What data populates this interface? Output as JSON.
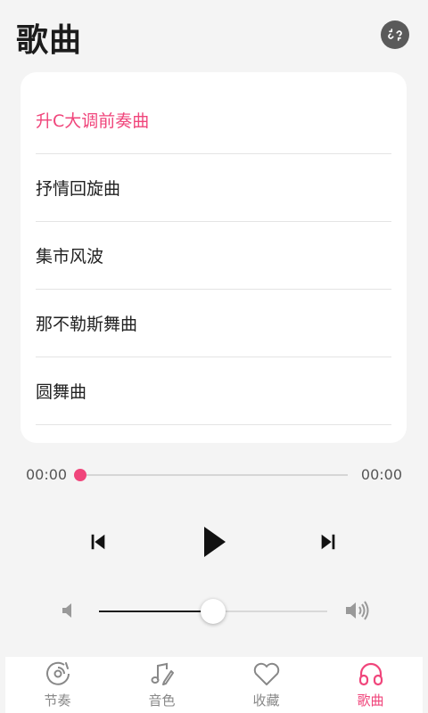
{
  "header": {
    "title": "歌曲",
    "unlink_icon": "unlink-icon"
  },
  "songs": [
    {
      "title": "升C大调前奏曲",
      "active": true
    },
    {
      "title": "抒情回旋曲",
      "active": false
    },
    {
      "title": "集市风波",
      "active": false
    },
    {
      "title": "那不勒斯舞曲",
      "active": false
    },
    {
      "title": "圆舞曲",
      "active": false
    }
  ],
  "player": {
    "current_time": "00:00",
    "total_time": "00:00",
    "progress": 0,
    "volume": 0.5
  },
  "controls": {
    "previous_icon": "skip-previous-icon",
    "play_icon": "play-icon",
    "next_icon": "skip-next-icon",
    "volume_low_icon": "volume-low-icon",
    "volume_high_icon": "volume-high-icon"
  },
  "tabs": [
    {
      "label": "节奏",
      "icon": "disc-icon",
      "active": false
    },
    {
      "label": "音色",
      "icon": "music-note-icon",
      "active": false
    },
    {
      "label": "收藏",
      "icon": "heart-icon",
      "active": false
    },
    {
      "label": "歌曲",
      "icon": "headphones-icon",
      "active": true
    }
  ],
  "colors": {
    "accent": "#f0457b",
    "background": "#f4f4f4",
    "card": "#ffffff",
    "inactive": "#888888"
  }
}
